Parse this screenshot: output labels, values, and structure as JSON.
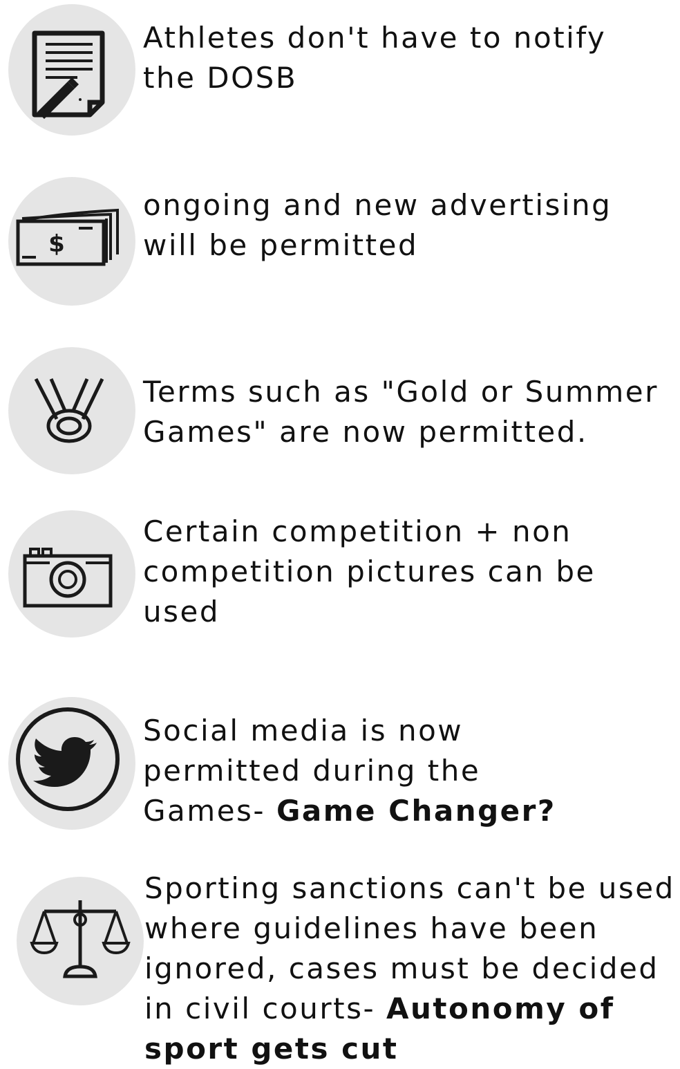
{
  "items": [
    {
      "icon": "document-pencil-icon",
      "text": "Athletes don't have to notify the DOSB",
      "bold": ""
    },
    {
      "icon": "money-stack-icon",
      "text": "ongoing and new advertising will be permitted",
      "bold": ""
    },
    {
      "icon": "medal-icon",
      "text": "Terms such as \"Gold or Summer Games\" are now permitted.",
      "bold": ""
    },
    {
      "icon": "camera-icon",
      "text": "Certain competition + non competition pictures can be used",
      "bold": ""
    },
    {
      "icon": "twitter-bird-icon",
      "text": "Social media is now permitted during the Games- ",
      "bold": "Game Changer?"
    },
    {
      "icon": "scales-of-justice-icon",
      "text": "Sporting sanctions can't be used where guidelines have been ignored, cases must be decided in civil courts- ",
      "bold": "Autonomy of sport gets cut"
    }
  ],
  "colors": {
    "circle": "#e5e5e5",
    "icon": "#1a1a1a",
    "text": "#111111"
  }
}
